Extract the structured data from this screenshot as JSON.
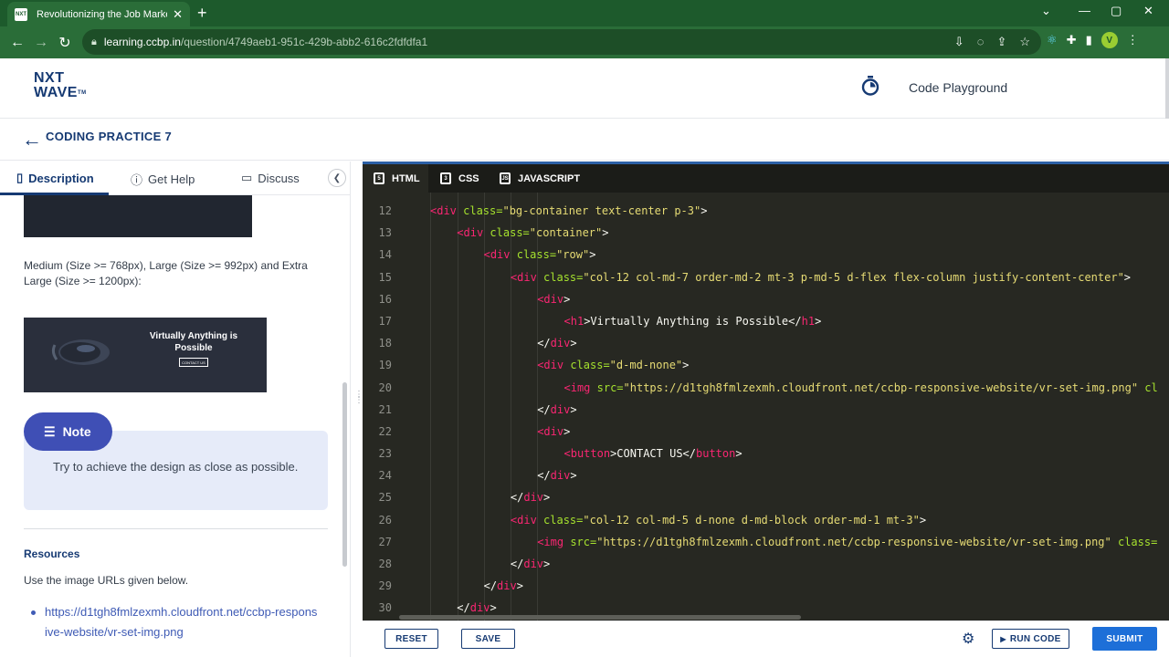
{
  "browser": {
    "tab_title": "Revolutionizing the Job Market |",
    "favicon_text": "NXT",
    "url_host": "learning.ccbp.in",
    "url_path": "/question/4749aeb1-951c-429b-abb2-616c2fdfdfa1",
    "avatar_letter": "V"
  },
  "site": {
    "logo_line1": "NXT",
    "logo_line2": "WAVE",
    "logo_tm": "TM",
    "playground_label": "Code Playground"
  },
  "practice": {
    "title": "CODING PRACTICE 7"
  },
  "left_panel": {
    "tabs": [
      {
        "label": "Description"
      },
      {
        "label": "Get Help"
      },
      {
        "label": "Discuss"
      }
    ],
    "size_text": "Medium (Size >= 768px), Large (Size >= 992px) and Extra Large (Size >= 1200px):",
    "preview_title": "Virtually Anything is Possible",
    "preview_button": "CONTACT US",
    "note_label": "Note",
    "note_text": "Try to achieve the design as close as possible.",
    "resources_title": "Resources",
    "resources_desc": "Use the image URLs given below.",
    "resource_link": "https://d1tgh8fmlzexmh.cloudfront.net/ccbp-responsive-website/vr-set-img.png"
  },
  "editor": {
    "tabs": [
      {
        "label": "HTML"
      },
      {
        "label": "CSS"
      },
      {
        "label": "JAVASCRIPT"
      }
    ],
    "lines": [
      {
        "num": "12",
        "indent": 0,
        "tokens": [
          [
            "tag",
            "<div"
          ],
          [
            "attr",
            " class="
          ],
          [
            "str",
            "\"bg-container text-center p-3\""
          ],
          [
            "txt",
            ">"
          ]
        ]
      },
      {
        "num": "13",
        "indent": 1,
        "tokens": [
          [
            "tag",
            "<div"
          ],
          [
            "attr",
            " class="
          ],
          [
            "str",
            "\"container\""
          ],
          [
            "txt",
            ">"
          ]
        ]
      },
      {
        "num": "14",
        "indent": 2,
        "tokens": [
          [
            "tag",
            "<div"
          ],
          [
            "attr",
            " class="
          ],
          [
            "str",
            "\"row\""
          ],
          [
            "txt",
            ">"
          ]
        ]
      },
      {
        "num": "15",
        "indent": 3,
        "tokens": [
          [
            "tag",
            "<div"
          ],
          [
            "attr",
            " class="
          ],
          [
            "str",
            "\"col-12 col-md-7 order-md-2 mt-3 p-md-5 d-flex flex-column justify-content-center\""
          ],
          [
            "txt",
            ">"
          ]
        ]
      },
      {
        "num": "16",
        "indent": 4,
        "tokens": [
          [
            "tag",
            "<div"
          ],
          [
            "txt",
            ">"
          ]
        ]
      },
      {
        "num": "17",
        "indent": 5,
        "tokens": [
          [
            "tag",
            "<h1"
          ],
          [
            "txt",
            ">Virtually Anything is Possible</"
          ],
          [
            "tag",
            "h1"
          ],
          [
            "txt",
            ">"
          ]
        ]
      },
      {
        "num": "18",
        "indent": 4,
        "tokens": [
          [
            "txt",
            "</"
          ],
          [
            "tag",
            "div"
          ],
          [
            "txt",
            ">"
          ]
        ]
      },
      {
        "num": "19",
        "indent": 4,
        "tokens": [
          [
            "tag",
            "<div"
          ],
          [
            "attr",
            " class="
          ],
          [
            "str",
            "\"d-md-none\""
          ],
          [
            "txt",
            ">"
          ]
        ]
      },
      {
        "num": "20",
        "indent": 5,
        "tokens": [
          [
            "tag",
            "<img"
          ],
          [
            "attr",
            " src="
          ],
          [
            "str",
            "\"https://d1tgh8fmlzexmh.cloudfront.net/ccbp-responsive-website/vr-set-img.png\""
          ],
          [
            "attr",
            " cl"
          ]
        ]
      },
      {
        "num": "21",
        "indent": 4,
        "tokens": [
          [
            "txt",
            "</"
          ],
          [
            "tag",
            "div"
          ],
          [
            "txt",
            ">"
          ]
        ]
      },
      {
        "num": "22",
        "indent": 4,
        "tokens": [
          [
            "tag",
            "<div"
          ],
          [
            "txt",
            ">"
          ]
        ]
      },
      {
        "num": "23",
        "indent": 5,
        "tokens": [
          [
            "tag",
            "<button"
          ],
          [
            "txt",
            ">CONTACT US</"
          ],
          [
            "tag",
            "button"
          ],
          [
            "txt",
            ">"
          ]
        ]
      },
      {
        "num": "24",
        "indent": 4,
        "tokens": [
          [
            "txt",
            "</"
          ],
          [
            "tag",
            "div"
          ],
          [
            "txt",
            ">"
          ]
        ]
      },
      {
        "num": "25",
        "indent": 3,
        "tokens": [
          [
            "txt",
            "</"
          ],
          [
            "tag",
            "div"
          ],
          [
            "txt",
            ">"
          ]
        ]
      },
      {
        "num": "26",
        "indent": 3,
        "tokens": [
          [
            "tag",
            "<div"
          ],
          [
            "attr",
            " class="
          ],
          [
            "str",
            "\"col-12 col-md-5 d-none d-md-block order-md-1 mt-3\""
          ],
          [
            "txt",
            ">"
          ]
        ]
      },
      {
        "num": "27",
        "indent": 4,
        "tokens": [
          [
            "tag",
            "<img"
          ],
          [
            "attr",
            " src="
          ],
          [
            "str",
            "\"https://d1tgh8fmlzexmh.cloudfront.net/ccbp-responsive-website/vr-set-img.png\""
          ],
          [
            "attr",
            " class="
          ]
        ]
      },
      {
        "num": "28",
        "indent": 3,
        "tokens": [
          [
            "txt",
            "</"
          ],
          [
            "tag",
            "div"
          ],
          [
            "txt",
            ">"
          ]
        ]
      },
      {
        "num": "29",
        "indent": 2,
        "tokens": [
          [
            "txt",
            "</"
          ],
          [
            "tag",
            "div"
          ],
          [
            "txt",
            ">"
          ]
        ]
      },
      {
        "num": "30",
        "indent": 1,
        "tokens": [
          [
            "txt",
            "</"
          ],
          [
            "tag",
            "div"
          ],
          [
            "txt",
            ">"
          ]
        ]
      }
    ]
  },
  "bottom": {
    "reset_label": "RESET",
    "save_label": "SAVE",
    "run_label": "RUN CODE",
    "submit_label": "SUBMIT"
  },
  "colors": {
    "browser_frame": "#1d5a2c",
    "brand_navy": "#163a73",
    "note_accent": "#3f4fb5",
    "submit_blue": "#1d6fd8",
    "editor_bg": "#272822"
  }
}
